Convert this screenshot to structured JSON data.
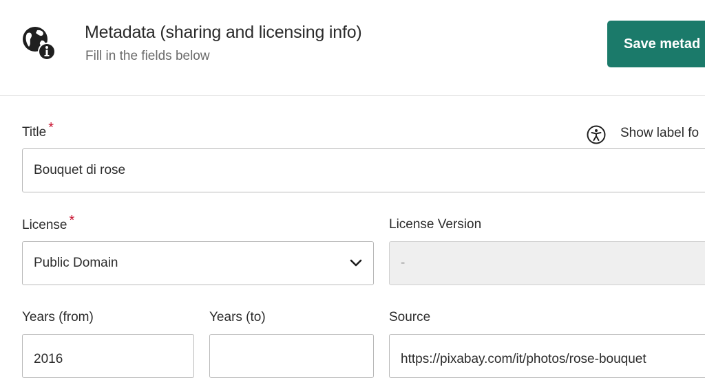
{
  "header": {
    "title": "Metadata (sharing and licensing info)",
    "subtitle": "Fill in the fields below",
    "icon": "globe-info-icon",
    "save_label": "Save metad"
  },
  "accessibility": {
    "icon": "accessibility-icon",
    "label": "Show label fo"
  },
  "fields": {
    "title": {
      "label": "Title",
      "required_mark": "*",
      "value": "Bouquet di rose"
    },
    "license": {
      "label": "License",
      "required_mark": "*",
      "value": "Public Domain"
    },
    "license_version": {
      "label": "License Version",
      "value": "-"
    },
    "years_from": {
      "label": "Years (from)",
      "value": "2016"
    },
    "years_to": {
      "label": "Years (to)",
      "value": ""
    },
    "source": {
      "label": "Source",
      "value": "https://pixabay.com/it/photos/rose-bouquet"
    }
  },
  "colors": {
    "accent": "#1b7a6a",
    "required": "#c8102e",
    "border": "#b8b8b8",
    "disabled_bg": "#efefef"
  }
}
